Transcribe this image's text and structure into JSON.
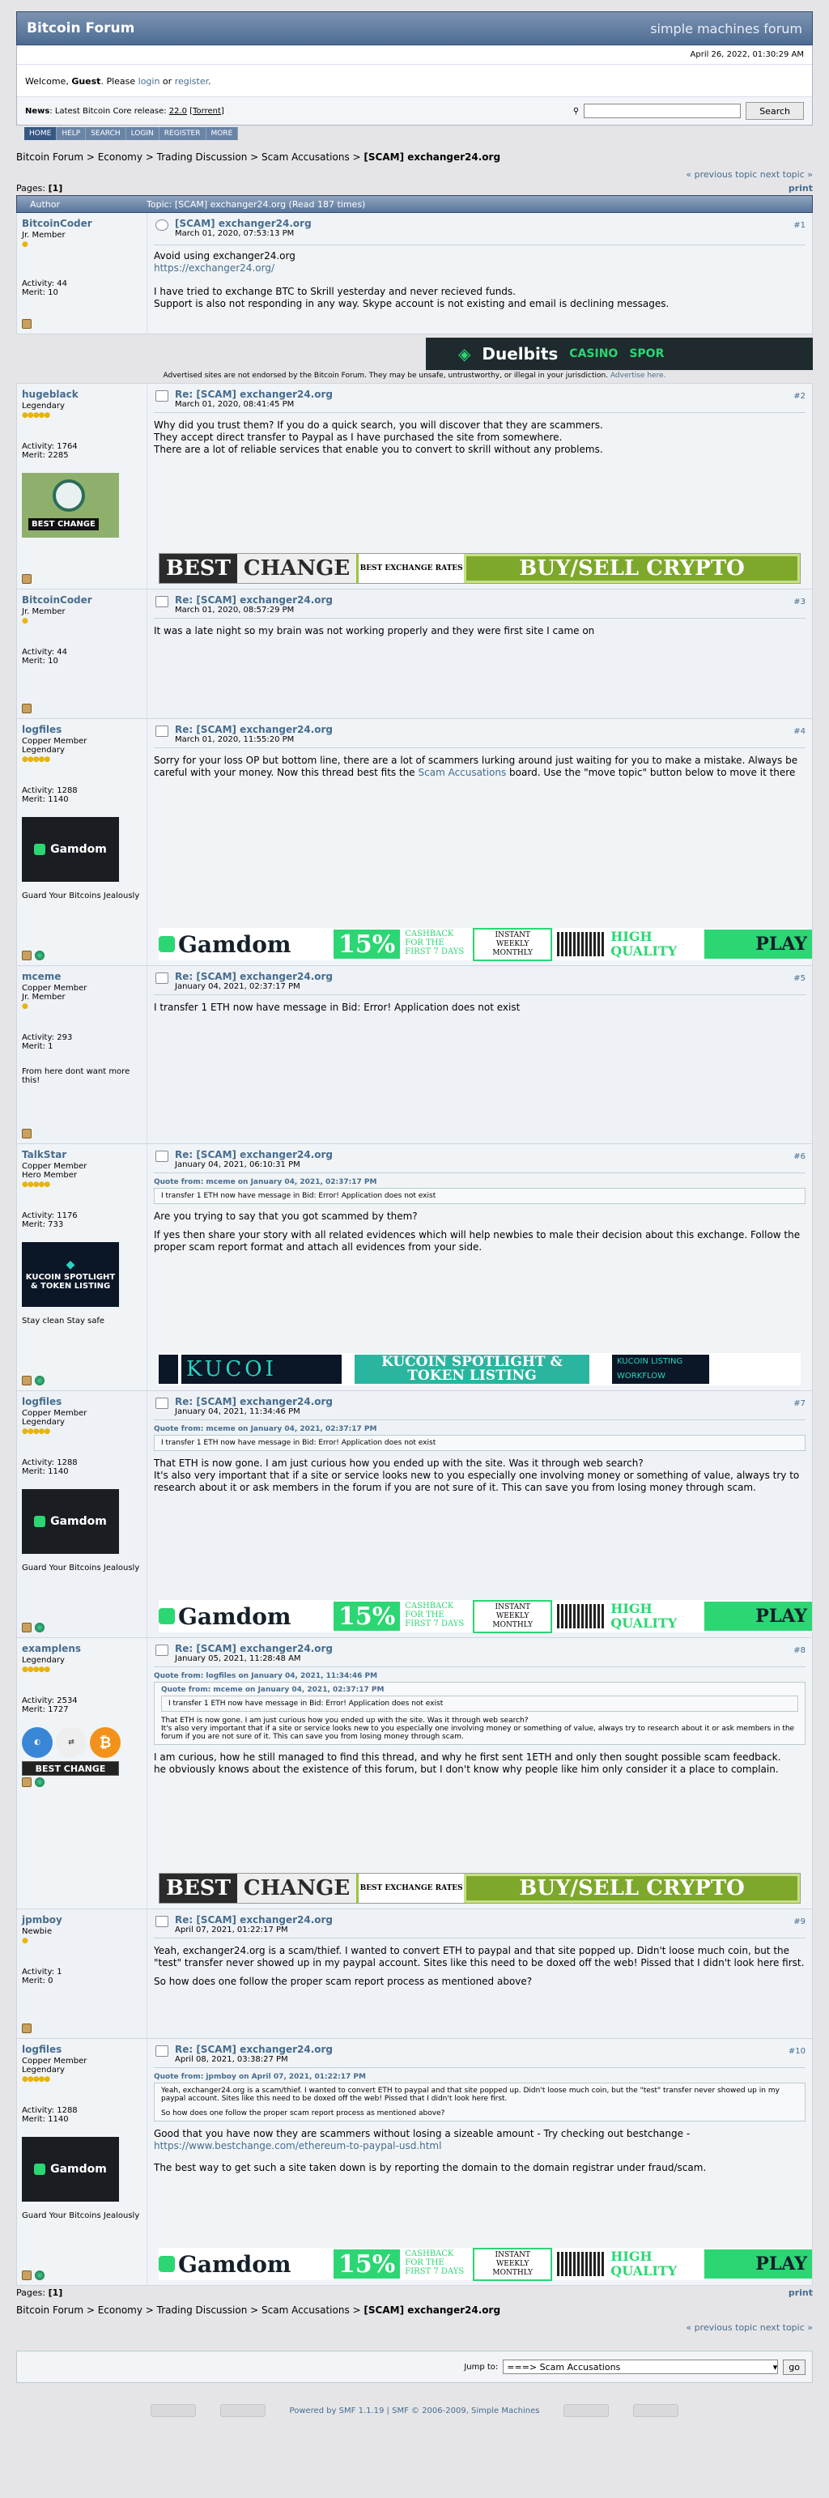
{
  "site": {
    "title": "Bitcoin Forum",
    "brand": "simple machines forum"
  },
  "header": {
    "date": "April 26, 2022, 01:30:29 AM",
    "welcome_pre": "Welcome, ",
    "guest": "Guest",
    "welcome_mid": ". Please ",
    "login": "login",
    "or": " or ",
    "register": "register",
    "dot": ".",
    "news_label": "News",
    "news_text": ": Latest Bitcoin Core release: ",
    "news_ver": "22.0",
    "news_torrent": "[Torrent]",
    "search_btn": "Search"
  },
  "menu": [
    "HOME",
    "HELP",
    "SEARCH",
    "LOGIN",
    "REGISTER",
    "MORE"
  ],
  "crumbs": {
    "a": "Bitcoin Forum",
    "b": "Economy",
    "c": "Trading Discussion",
    "d": "Scam Accusations",
    "e": "[SCAM] exchanger24.org",
    "sep": " > "
  },
  "nav": {
    "prev": "« previous topic",
    "next": "next topic »",
    "pages_label": "Pages: ",
    "page": "[1]",
    "print": "print"
  },
  "thead": {
    "author": "Author",
    "topic": "Topic: [SCAM] exchanger24.org  (Read 187 times)"
  },
  "ad": {
    "text": "Advertised sites are not endorsed by the Bitcoin Forum. They may be unsafe, untrustworthy, or illegal in your jurisdiction.",
    "link": "Advertise here.",
    "duel": "Duelbits",
    "casino": "CASINO",
    "sports": "SPOR"
  },
  "banners": {
    "bc": {
      "best": "BEST",
      "change": "CHANGE",
      "rates": "BEST EXCHANGE RATES",
      "buy": "BUY/SELL CRYPTO"
    },
    "g": {
      "name": "Gamdom",
      "pct": "15%",
      "cash": "CASHBACK FOR THE FIRST 7 DAYS",
      "inst": "INSTANT WEEKLY MONTHLY",
      "hq": "HIGH QUALITY",
      "play": "PLAY"
    },
    "k": {
      "name": "KUCOI",
      "spot": "KUCOIN SPOTLIGHT & TOKEN LISTING",
      "wf": "KUCOIN LISTING WORKFLOW"
    }
  },
  "posts": [
    {
      "user": "BitcoinCoder",
      "rank": "Jr. Member",
      "stars": "●",
      "activity": "Activity: 44",
      "merit": "Merit: 10",
      "title": "[SCAM] exchanger24.org",
      "date": "March 01, 2020, 07:53:13 PM",
      "num": "#1",
      "l1": "Avoid using exchanger24.org",
      "link": "https://exchanger24.org/",
      "l2": "I have tried to exchange BTC to Skrill yesterday and never recieved funds.",
      "l3": "Support is also not responding in any way. Skype account is not existing and email is declining messages."
    },
    {
      "user": "hugeblack",
      "rank": "Legendary",
      "stars": "●●●●●",
      "activity": "Activity: 1764",
      "merit": "Merit: 2285",
      "av": "BEST CHANGE",
      "title": "Re: [SCAM] exchanger24.org",
      "date": "March 01, 2020, 08:41:45 PM",
      "num": "#2",
      "l1": "Why did you trust them? If you do a quick search, you will discover that they are scammers.",
      "l2": "They accept direct transfer to Paypal as I have purchased the site from somewhere.",
      "l3": "There are a lot of reliable services that enable you to convert to skrill without any problems."
    },
    {
      "user": "BitcoinCoder",
      "rank": "Jr. Member",
      "stars": "●",
      "activity": "Activity: 44",
      "merit": "Merit: 10",
      "title": "Re: [SCAM] exchanger24.org",
      "date": "March 01, 2020, 08:57:29 PM",
      "num": "#3",
      "l1": "It was a late night so my brain was not working properly and they were first site I came on"
    },
    {
      "user": "logfiles",
      "rank": "Copper Member",
      "rank2": "Legendary",
      "stars": "●●●●●",
      "activity": "Activity: 1288",
      "merit": "Merit: 1140",
      "av": "Gamdom",
      "sig": "Guard Your Bitcoins Jealously",
      "title": "Re: [SCAM] exchanger24.org",
      "date": "March 01, 2020, 11:55:20 PM",
      "num": "#4",
      "l1": "Sorry for your loss OP but bottom line, there are a lot of scammers lurking around just waiting for you to make a mistake. Always be careful with your money. Now this thread best fits the ",
      "link": "Scam Accusations",
      "l2": " board. Use the \"move topic\" button below to move it there"
    },
    {
      "user": "mceme",
      "rank": "Copper Member",
      "rank2": "Jr. Member",
      "stars": "●",
      "activity": "Activity: 293",
      "merit": "Merit: 1",
      "sig": "From here dont want more this!",
      "title": "Re: [SCAM] exchanger24.org",
      "date": "January 04, 2021, 02:37:17 PM",
      "num": "#5",
      "l1": "I transfer 1 ETH now have message in Bid: Error! Application does not exist"
    },
    {
      "user": "TalkStar",
      "rank": "Copper Member",
      "rank2": "Hero Member",
      "stars": "●●●●●",
      "activity": "Activity: 1176",
      "merit": "Merit: 733",
      "av": "KUCOIN SPOTLIGHT & TOKEN LISTING",
      "sig": "Stay clean   Stay safe",
      "title": "Re: [SCAM] exchanger24.org",
      "date": "January 04, 2021, 06:10:31 PM",
      "num": "#6",
      "qh": "Quote from: mceme on January 04, 2021, 02:37:17 PM",
      "q": "I transfer 1 ETH now have message in Bid: Error! Application does not exist",
      "l1": "Are you trying to say that you got scammed by them?",
      "l2": "If yes then share your story with all related evidences which will help newbies to male their decision about this exchange. Follow the proper scam report format and attach all evidences from your side."
    },
    {
      "user": "logfiles",
      "rank": "Copper Member",
      "rank2": "Legendary",
      "stars": "●●●●●",
      "activity": "Activity: 1288",
      "merit": "Merit: 1140",
      "av": "Gamdom",
      "sig": "Guard Your Bitcoins Jealously",
      "title": "Re: [SCAM] exchanger24.org",
      "date": "January 04, 2021, 11:34:46 PM",
      "num": "#7",
      "qh": "Quote from: mceme on January 04, 2021, 02:37:17 PM",
      "q": "I transfer 1 ETH now have message in Bid: Error! Application does not exist",
      "l1": "That ETH is now gone. I am just curious how you ended up with the site. Was it through web search?",
      "l2": "It's also very important that if a site or service looks new to you especially one involving money or something of value, always try to research about it or ask members in the forum if you are not sure of it. This can save you from losing money through scam."
    },
    {
      "user": "examplens",
      "rank": "Legendary",
      "stars": "●●●●●",
      "activity": "Activity: 2534",
      "merit": "Merit: 1727",
      "av": "BEST CHANGE",
      "title": "Re: [SCAM] exchanger24.org",
      "date": "January 05, 2021, 11:28:48 AM",
      "num": "#8",
      "qh": "Quote from: logfiles on January 04, 2021, 11:34:46 PM",
      "qh2": "Quote from: mceme on January 04, 2021, 02:37:17 PM",
      "q2": "I transfer 1 ETH now have message in Bid: Error! Application does not exist",
      "q": "That ETH is now gone. I am just curious how you ended up with the site. Was it through web search?",
      "q3": "It's also very important that if a site or service looks new to you especially one involving money or something of value, always try to research about it or ask members in the forum if you are not sure of it. This can save you from losing money through scam.",
      "l1": "I am curious, how he still managed to find this thread, and why he first sent 1ETH and only then sought possible scam feedback.",
      "l2": "he obviously knows about the existence of this forum, but I don't know why people like him only consider it a place to complain."
    },
    {
      "user": "jpmboy",
      "rank": "Newbie",
      "stars": "●",
      "activity": "Activity: 1",
      "merit": "Merit: 0",
      "title": "Re: [SCAM] exchanger24.org",
      "date": "April 07, 2021, 01:22:17 PM",
      "num": "#9",
      "l1": "Yeah, exchanger24.org is a scam/thief. I wanted to convert ETH to paypal and that site popped up.  Didn't loose much coin, but the \"test\" transfer never showed up in my paypal account.  Sites like this need to be doxed off the web!  Pissed that I didn't look here first.",
      "l2": "So how does one follow the proper scam report process as mentioned above?"
    },
    {
      "user": "logfiles",
      "rank": "Copper Member",
      "rank2": "Legendary",
      "stars": "●●●●●",
      "activity": "Activity: 1288",
      "merit": "Merit: 1140",
      "av": "Gamdom",
      "sig": "Guard Your Bitcoins Jealously",
      "title": "Re: [SCAM] exchanger24.org",
      "date": "April 08, 2021, 03:38:27 PM",
      "num": "#10",
      "qh": "Quote from: jpmboy on April 07, 2021, 01:22:17 PM",
      "q": "Yeah, exchanger24.org is a scam/thief. I wanted to convert ETH to paypal and that site popped up.  Didn't loose much coin, but the \"test\" transfer never showed up in my paypal account.  Sites like this need to be doxed off the web!  Pissed that I didn't look here first.",
      "q3": "So how does one follow the proper scam report process as mentioned above?",
      "l1": "Good that you have now they are scammers without losing a sizeable amount - Try checking out bestchange  -",
      "link": "https://www.bestchange.com/ethereum-to-paypal-usd.html",
      "l2": "The best way to get such a site taken down is by reporting the domain to the domain registrar under fraud/scam."
    }
  ],
  "footer": {
    "jump": "Jump to:",
    "sel": "===> Scam Accusations",
    "go": "go",
    "powered": "Powered by SMF 1.1.19 | SMF © 2006-2009, Simple Machines"
  }
}
